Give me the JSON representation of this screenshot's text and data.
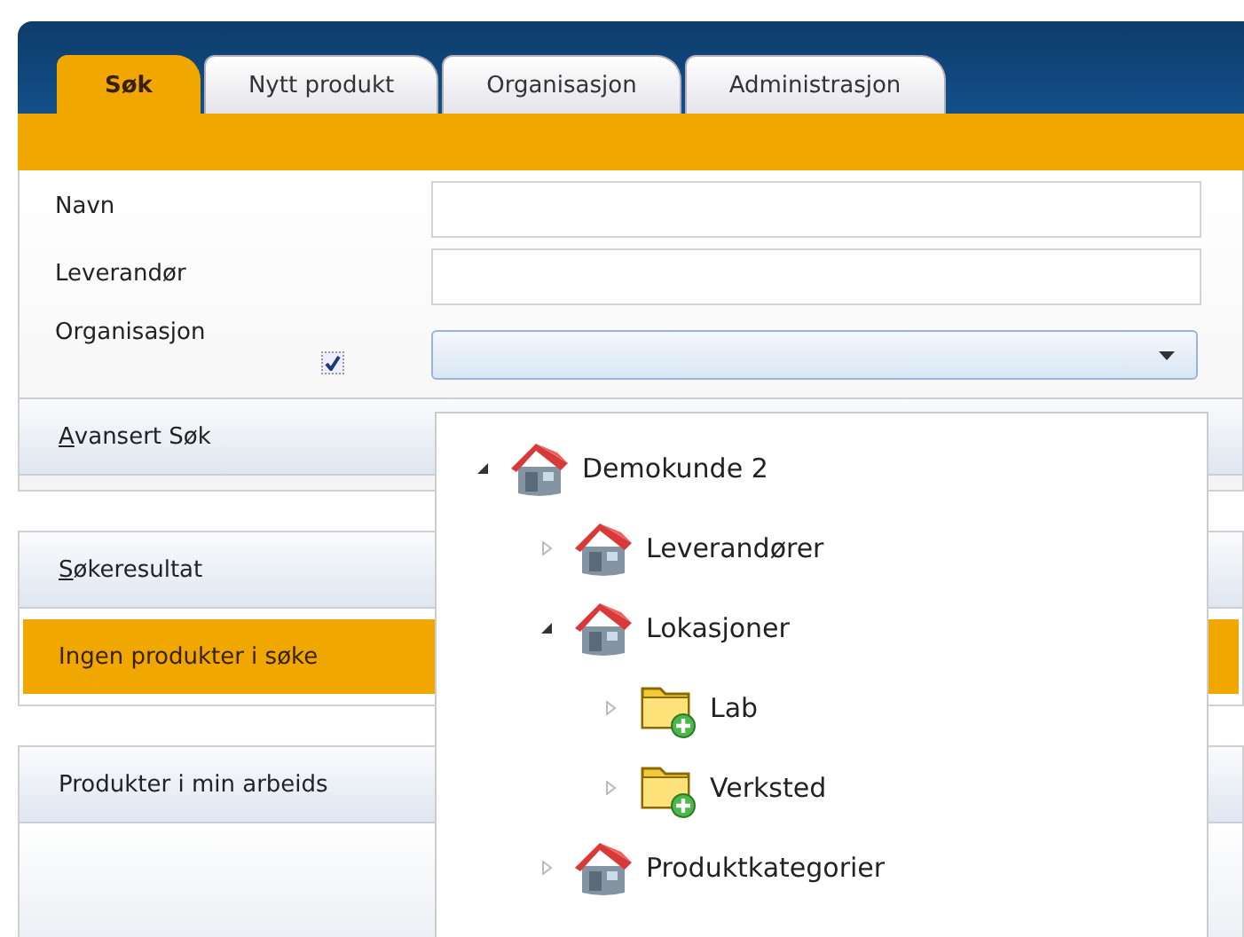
{
  "tabs": [
    {
      "label": "Søk",
      "selected": true
    },
    {
      "label": "Nytt produkt",
      "selected": false
    },
    {
      "label": "Organisasjon",
      "selected": false
    },
    {
      "label": "Administrasjon",
      "selected": false
    }
  ],
  "form": {
    "fields": [
      {
        "label": "Navn",
        "kind": "text"
      },
      {
        "label": "Leverandør",
        "kind": "text"
      },
      {
        "label": "Organisasjon",
        "kind": "combo",
        "checked": true
      }
    ]
  },
  "advanced_search": {
    "label": "Avansert Søk"
  },
  "search_results": {
    "label": "Søkeresultat",
    "message": "Ingen produkter i søke"
  },
  "workspace": {
    "label": "Produkter i min arbeids"
  },
  "dropdown_tree": [
    {
      "label": "Demokunde 2",
      "kind": "building",
      "expanded": true,
      "children": [
        {
          "label": "Leverandører",
          "kind": "building",
          "expanded": false
        },
        {
          "label": "Lokasjoner",
          "kind": "building",
          "expanded": true,
          "children": [
            {
              "label": "Lab",
              "kind": "folder",
              "expanded": false
            },
            {
              "label": "Verksted",
              "kind": "folder",
              "expanded": false
            }
          ]
        },
        {
          "label": "Produktkategorier",
          "kind": "building",
          "expanded": false
        }
      ]
    }
  ]
}
